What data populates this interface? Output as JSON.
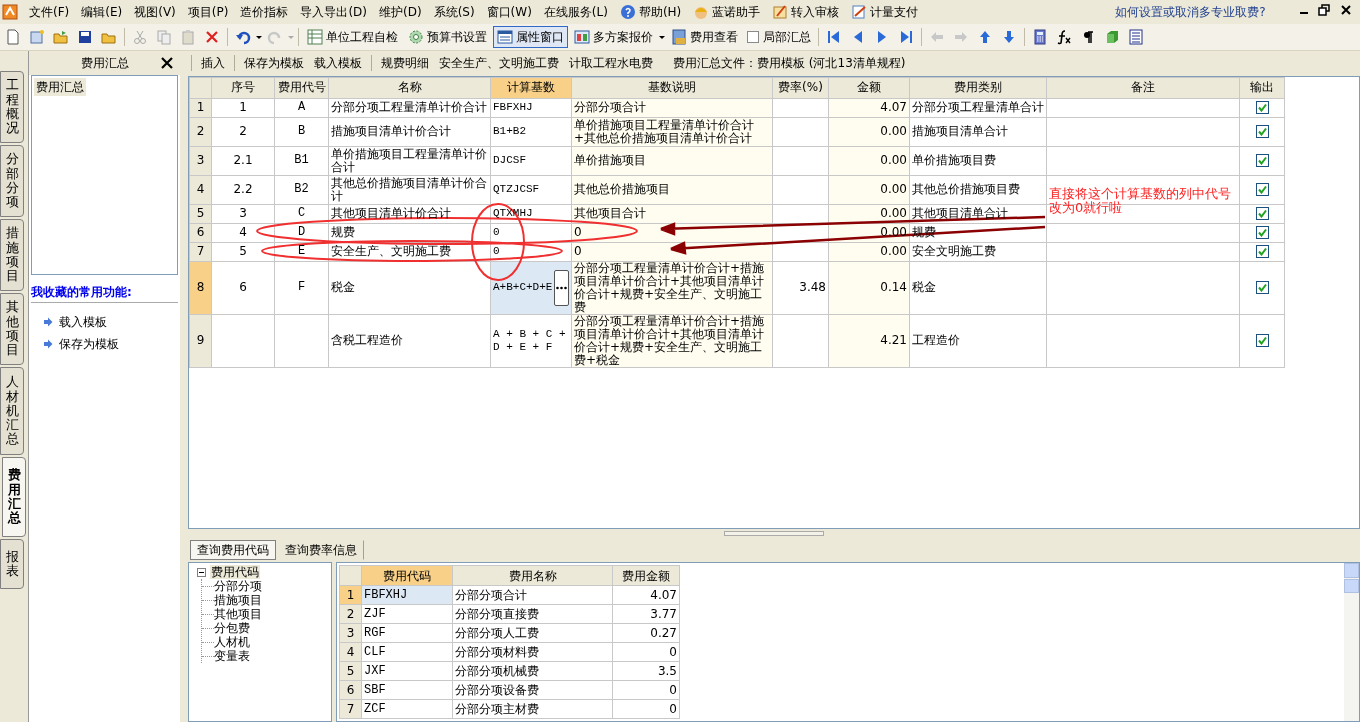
{
  "menu": [
    {
      "label": "文件(F)"
    },
    {
      "label": "编辑(E)"
    },
    {
      "label": "视图(V)"
    },
    {
      "label": "项目(P)"
    },
    {
      "label": "造价指标"
    },
    {
      "label": "导入导出(D)"
    },
    {
      "label": "维护(D)"
    },
    {
      "label": "系统(S)"
    },
    {
      "label": "窗口(W)"
    },
    {
      "label": "在线服务(L)"
    },
    {
      "label": "帮助(H)",
      "kind": "help"
    },
    {
      "label": "蓝诺助手",
      "kind": "helper"
    },
    {
      "label": "转入审核",
      "kind": "audit"
    },
    {
      "label": "计量支付",
      "kind": "pay"
    }
  ],
  "help_link": "如何设置或取消多专业取费?",
  "toolbar": [
    {
      "label": "单位工程自检",
      "kind": "check",
      "selected": false
    },
    {
      "label": "预算书设置",
      "kind": "gear",
      "selected": false
    },
    {
      "label": "属性窗口",
      "kind": "window",
      "selected": true
    },
    {
      "label": "多方案报价",
      "kind": "plan",
      "selected": false
    },
    {
      "label": "费用查看",
      "kind": "view",
      "selected": false
    },
    {
      "label": "局部汇总",
      "kind": "checkbox",
      "checked": false
    }
  ],
  "side_tabs": [
    {
      "label": "工程概况",
      "selected": false
    },
    {
      "label": "分部分项",
      "selected": false
    },
    {
      "label": "措施项目",
      "selected": false
    },
    {
      "label": "其他项目",
      "selected": false
    },
    {
      "label": "人材机汇总",
      "selected": false
    },
    {
      "label": "费用汇总",
      "selected": true
    },
    {
      "label": "报表",
      "selected": false
    }
  ],
  "side_panel": {
    "title": "费用汇总",
    "tree_item": "费用汇总",
    "favorites_title": "我收藏的常用功能:",
    "favorites": [
      "载入模板",
      "保存为模板"
    ]
  },
  "sub_toolbar": [
    [
      "插入"
    ],
    [
      "保存为模板",
      "载入模板"
    ],
    [
      "规费明细",
      "安全生产、文明施工费",
      "计取工程水电费"
    ]
  ],
  "file_label": "费用汇总文件：费用模板 (河北13清单规程)",
  "table": {
    "columns": [
      "序号",
      "费用代号",
      "名称",
      "计算基数",
      "基数说明",
      "费率(%)",
      "金额",
      "费用类别",
      "备注",
      "输出"
    ],
    "rows": [
      {
        "num": "1",
        "seq": "1",
        "code": "A",
        "name": "分部分项工程量清单计价合计",
        "base": "FBFXHJ",
        "desc": "分部分项合计",
        "rate": "",
        "amount": "4.07",
        "category": "分部分项工程量清单合计",
        "output": true,
        "selected": false
      },
      {
        "num": "2",
        "seq": "2",
        "code": "B",
        "name": "措施项目清单计价合计",
        "base": "B1+B2",
        "desc": "单价措施项目工程量清单计价合计+其他总价措施项目清单计价合计",
        "rate": "",
        "amount": "0.00",
        "category": "措施项目清单合计",
        "output": true,
        "selected": false
      },
      {
        "num": "3",
        "seq": "2.1",
        "code": "B1",
        "name": "单价措施项目工程量清单计价合计",
        "base": "DJCSF",
        "desc": "单价措施项目",
        "rate": "",
        "amount": "0.00",
        "category": "单价措施项目费",
        "output": true,
        "selected": false
      },
      {
        "num": "4",
        "seq": "2.2",
        "code": "B2",
        "name": "其他总价措施项目清单计价合计",
        "base": "QTZJCSF",
        "desc": "其他总价措施项目",
        "rate": "",
        "amount": "0.00",
        "category": "其他总价措施项目费",
        "output": true,
        "selected": false
      },
      {
        "num": "5",
        "seq": "3",
        "code": "C",
        "name": "其他项目清单计价合计",
        "base": "QTXMHJ",
        "desc": "其他项目合计",
        "rate": "",
        "amount": "0.00",
        "category": "其他项目清单合计",
        "output": true,
        "selected": false
      },
      {
        "num": "6",
        "seq": "4",
        "code": "D",
        "name": "规费",
        "base": "0",
        "desc": "0",
        "rate": "",
        "amount": "0.00",
        "category": "规费",
        "output": true,
        "selected": false
      },
      {
        "num": "7",
        "seq": "5",
        "code": "E",
        "name": "安全生产、文明施工费",
        "base": "0",
        "desc": "0",
        "rate": "",
        "amount": "0.00",
        "category": "安全文明施工费",
        "output": true,
        "selected": false
      },
      {
        "num": "8",
        "seq": "6",
        "code": "F",
        "name": "税金",
        "base": "A+B+C+D+E",
        "desc": "分部分项工程量清单计价合计+措施项目清单计价合计+其他项目清单计价合计+规费+安全生产、文明施工费",
        "rate": "3.48",
        "amount": "0.14",
        "category": "税金",
        "output": true,
        "selected": true
      },
      {
        "num": "9",
        "seq": "",
        "code": "",
        "name": "含税工程造价",
        "base": "A + B + C + D + E + F",
        "desc": "分部分项工程量清单计价合计+措施项目清单计价合计+其他项目清单计价合计+规费+安全生产、文明施工费+税金",
        "rate": "",
        "amount": "4.21",
        "category": "工程造价",
        "output": true,
        "selected": false
      }
    ]
  },
  "annotation": "直接将这个计算基数的列中代号改为0就行啦",
  "bottom_tabs": [
    {
      "label": "查询费用代码",
      "selected": true
    },
    {
      "label": "查询费率信息",
      "selected": false
    }
  ],
  "code_tree": {
    "label": "费用代码",
    "expanded": true,
    "children": [
      {
        "label": "分部分项"
      },
      {
        "label": "措施项目"
      },
      {
        "label": "其他项目"
      },
      {
        "label": "分包费"
      },
      {
        "label": "人材机"
      },
      {
        "label": "变量表"
      }
    ]
  },
  "code_grid": {
    "columns": [
      "费用代码",
      "费用名称",
      "费用金额"
    ],
    "rows": [
      {
        "num": "1",
        "code": "FBFXHJ",
        "name": "分部分项合计",
        "amount": "4.07",
        "selected": true
      },
      {
        "num": "2",
        "code": "ZJF",
        "name": "分部分项直接费",
        "amount": "3.77",
        "selected": false
      },
      {
        "num": "3",
        "code": "RGF",
        "name": "分部分项人工费",
        "amount": "0.27",
        "selected": false
      },
      {
        "num": "4",
        "code": "CLF",
        "name": "分部分项材料费",
        "amount": "0",
        "selected": false
      },
      {
        "num": "5",
        "code": "JXF",
        "name": "分部分项机械费",
        "amount": "3.5",
        "selected": false
      },
      {
        "num": "6",
        "code": "SBF",
        "name": "分部分项设备费",
        "amount": "0",
        "selected": false
      },
      {
        "num": "7",
        "code": "ZCF",
        "name": "分部分项主材费",
        "amount": "0",
        "selected": false
      }
    ]
  }
}
